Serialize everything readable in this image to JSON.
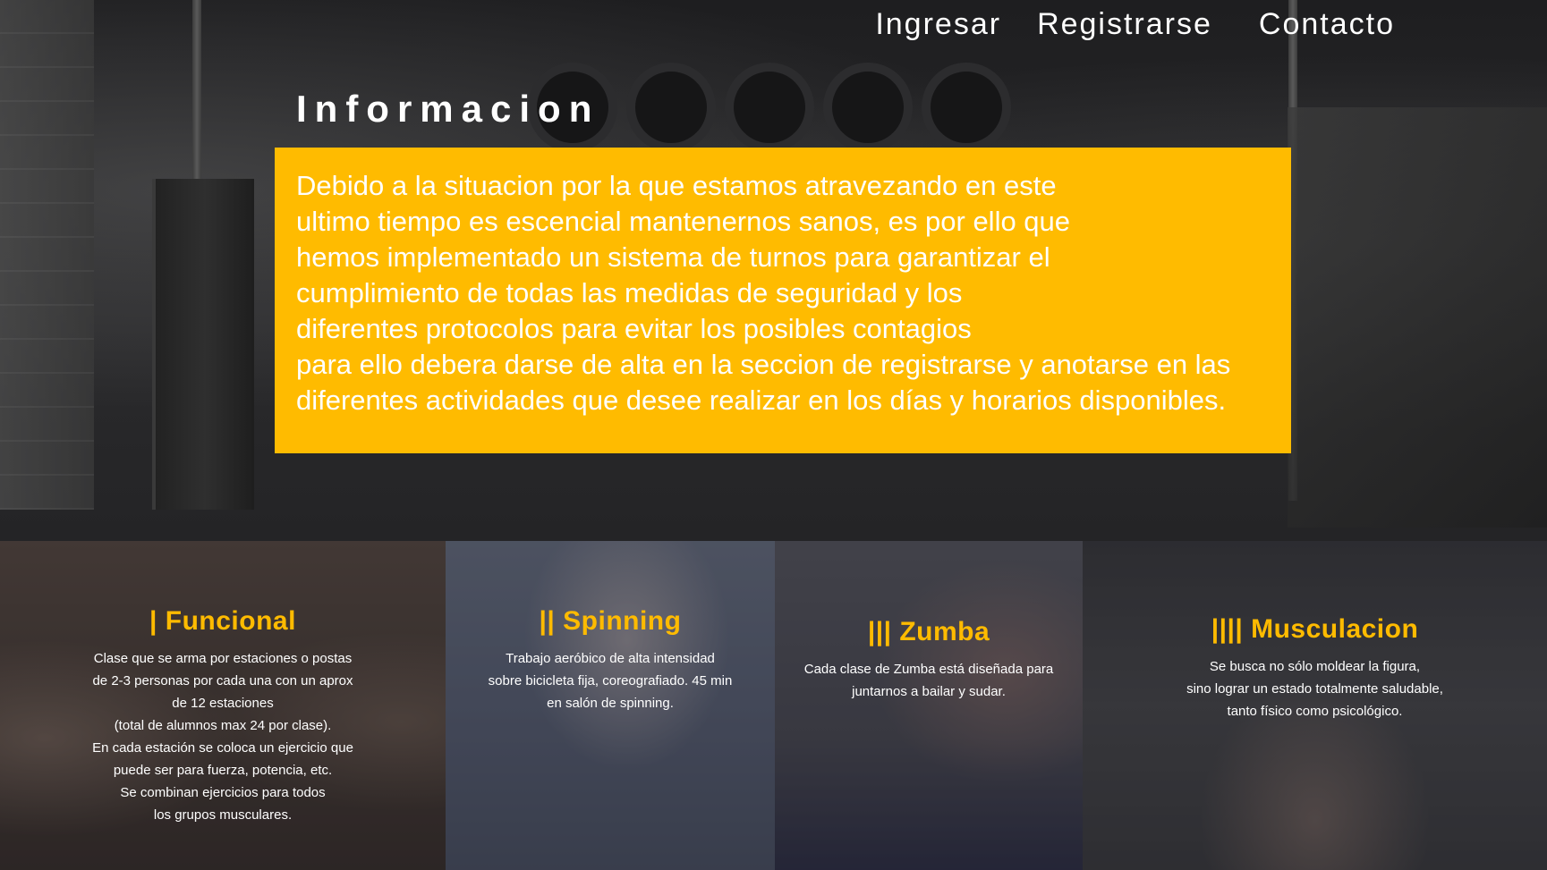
{
  "nav": {
    "login": "Ingresar",
    "register": "Registrarse",
    "contact": "Contacto"
  },
  "info": {
    "title": "Informacion",
    "text": [
      "Debido a la situacion por la que estamos atravezando en este",
      "ultimo tiempo es escencial mantenernos sanos, es por ello que",
      "hemos implementado un sistema de turnos para garantizar el",
      "cumplimiento de todas las medidas de seguridad y los",
      "diferentes protocolos para evitar los posibles contagios",
      "para ello debera darse de alta en la seccion de registrarse y anotarse en las",
      "diferentes actividades que desee realizar en los días y horarios disponibles."
    ]
  },
  "activities": [
    {
      "title": "| Funcional",
      "description": "Clase que se arma por estaciones o postas\nde 2-3 personas por cada una con un aprox\nde 12 estaciones\n(total de alumnos max 24 por clase).\nEn cada estación se coloca un ejercicio que\npuede ser para fuerza, potencia, etc.\nSe combinan ejercicios para todos\nlos grupos musculares."
    },
    {
      "title": "|| Spinning",
      "description": "Trabajo aeróbico de alta intensidad\nsobre bicicleta fija, coreografiado. 45 min\nen salón de spinning."
    },
    {
      "title": "||| Zumba",
      "description": "Cada clase de Zumba está diseñada para\njuntarnos a bailar y sudar."
    },
    {
      "title": "|||| Musculacion",
      "description": "Se busca no sólo moldear la figura,\nsino lograr un estado totalmente saludable,\ntanto físico como psicológico."
    }
  ],
  "colors": {
    "accent": "#ffbb00",
    "text": "#ffffff"
  }
}
